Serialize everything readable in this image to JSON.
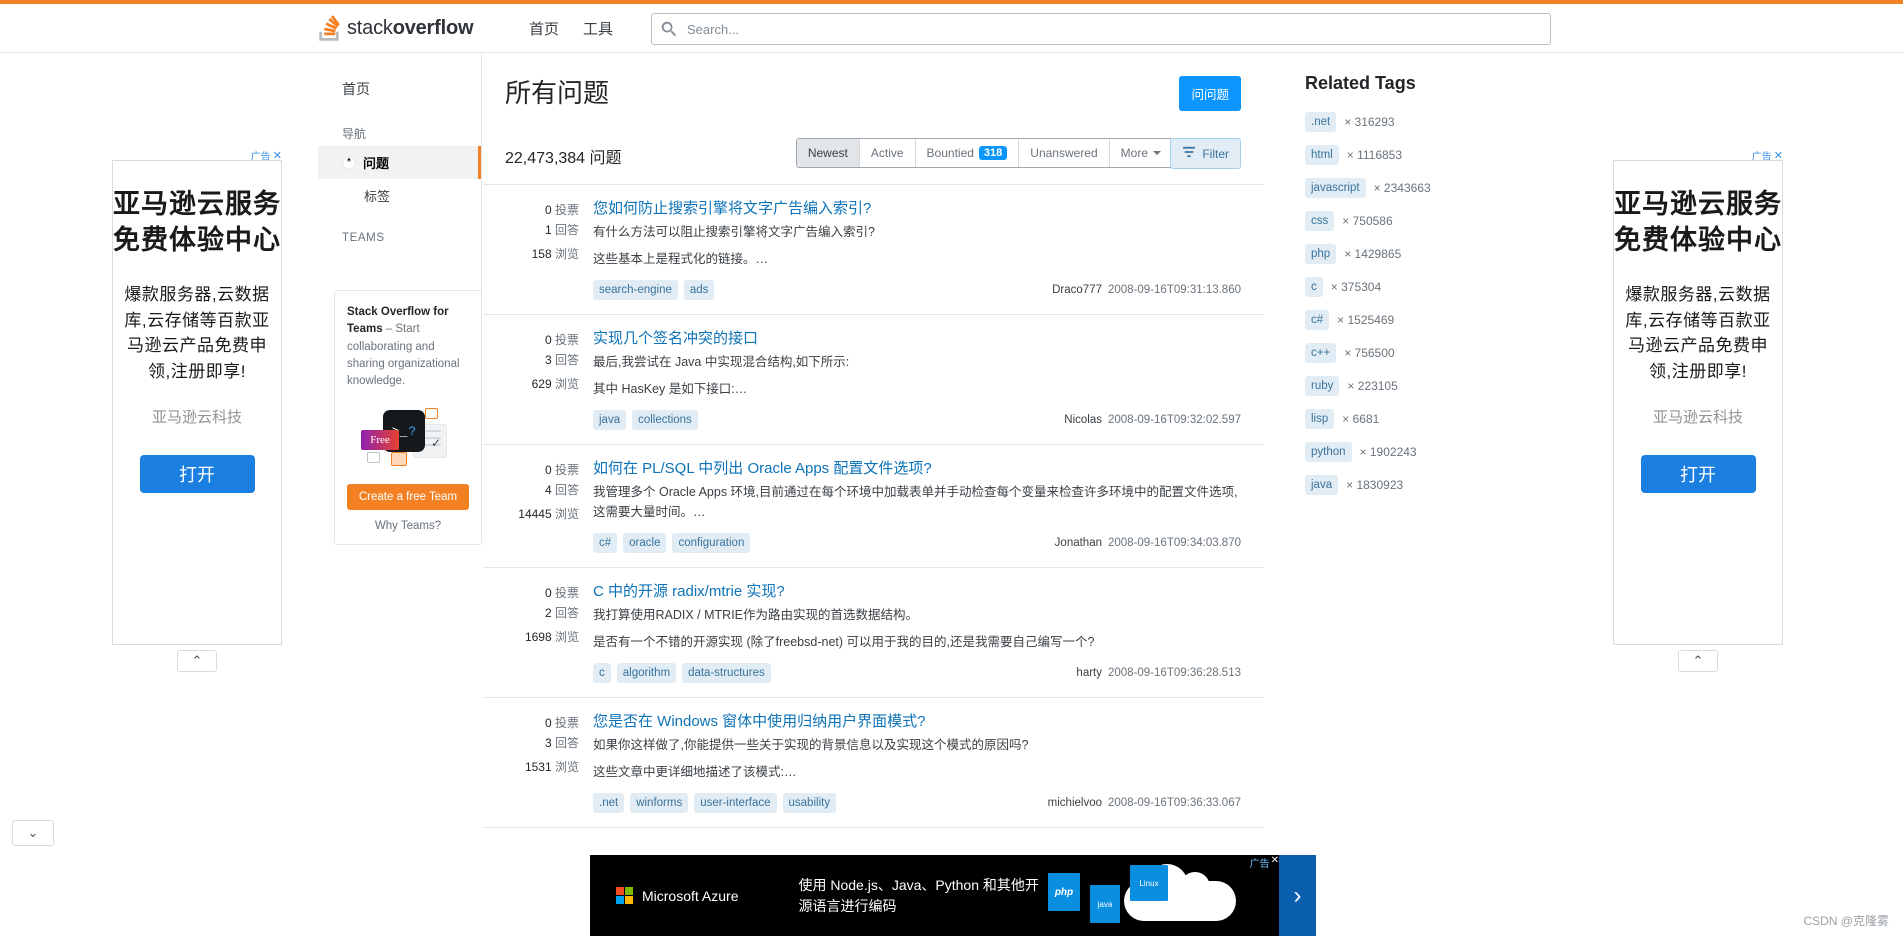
{
  "header": {
    "logo_text_light": "stack",
    "logo_text_bold": "overflow",
    "nav": [
      {
        "label": "首页",
        "name": "nav-home"
      },
      {
        "label": "工具",
        "name": "nav-tools"
      }
    ],
    "search_placeholder": "Search...",
    "search_value": ""
  },
  "sidebar": {
    "home_label": "首页",
    "section_nav": "导航",
    "items": [
      {
        "label": "问题",
        "active": true
      },
      {
        "label": "标签",
        "active": false
      }
    ],
    "section_teams": "TEAMS",
    "teams": {
      "title_bold": "Stack Overflow for Teams",
      "title_rest": " – Start collaborating and sharing organizational knowledge.",
      "terminal_glyph": ">_",
      "terminal_q": "?",
      "free_badge": "Free",
      "cta": "Create a free Team",
      "why": "Why Teams?"
    }
  },
  "main": {
    "page_title": "所有问题",
    "ask_button": "问问题",
    "question_count": "22,473,384 问题",
    "tabs": [
      {
        "label": "Newest",
        "active": true,
        "badge": null
      },
      {
        "label": "Active",
        "active": false,
        "badge": null
      },
      {
        "label": "Bountied",
        "active": false,
        "badge": "318"
      },
      {
        "label": "Unanswered",
        "active": false,
        "badge": null
      },
      {
        "label": "More",
        "active": false,
        "badge": null,
        "caret": true
      }
    ],
    "filter_button": "Filter",
    "labels": {
      "votes": "投票",
      "answers": "回答",
      "views": "浏览"
    },
    "questions": [
      {
        "votes": "0",
        "answers": "1",
        "views": "158",
        "title": "您如何防止搜索引擎将文字广告编入索引?",
        "excerpt_lines": [
          "有什么方法可以阻止搜索引擎将文字广告编入索引?",
          "这些基本上是程式化的链接。…"
        ],
        "tags": [
          "search-engine",
          "ads"
        ],
        "user": "Draco777",
        "time": "2008-09-16T09:31:13.860"
      },
      {
        "votes": "0",
        "answers": "3",
        "views": "629",
        "title": "实现几个签名冲突的接口",
        "excerpt_lines": [
          "最后,我尝试在 Java 中实现混合结构,如下所示:",
          "其中 HasKey 是如下接口:…"
        ],
        "tags": [
          "java",
          "collections"
        ],
        "user": "Nicolas",
        "time": "2008-09-16T09:32:02.597"
      },
      {
        "votes": "0",
        "answers": "4",
        "views": "14445",
        "title": "如何在 PL/SQL 中列出 Oracle Apps 配置文件选项?",
        "excerpt_lines": [
          "我管理多个 Oracle Apps 环境,目前通过在每个环境中加载表单并手动检查每个变量来检查许多环境中的配置文件选项,这需要大量时间。…"
        ],
        "tags": [
          "c#",
          "oracle",
          "configuration"
        ],
        "user": "Jonathan",
        "time": "2008-09-16T09:34:03.870"
      },
      {
        "votes": "0",
        "answers": "2",
        "views": "1698",
        "title": "C 中的开源 radix/mtrie 实现?",
        "excerpt_lines": [
          "我打算使用RADIX / MTRIE作为路由实现的首选数据结构。",
          "是否有一个不错的开源实现 (除了freebsd-net) 可以用于我的目的,还是我需要自己编写一个?"
        ],
        "tags": [
          "c",
          "algorithm",
          "data-structures"
        ],
        "user": "harty",
        "time": "2008-09-16T09:36:28.513"
      },
      {
        "votes": "0",
        "answers": "3",
        "views": "1531",
        "title": "您是否在 Windows 窗体中使用归纳用户界面模式?",
        "excerpt_lines": [
          "如果你这样做了,你能提供一些关于实现的背景信息以及实现这个模式的原因吗?",
          "这些文章中更详细地描述了该模式:…"
        ],
        "tags": [
          ".net",
          "winforms",
          "user-interface",
          "usability"
        ],
        "user": "michielvoo",
        "time": "2008-09-16T09:36:33.067"
      }
    ]
  },
  "related_tags": {
    "title": "Related Tags",
    "items": [
      {
        "tag": ".net",
        "count": "× 316293"
      },
      {
        "tag": "html",
        "count": "× 1116853"
      },
      {
        "tag": "javascript",
        "count": "× 2343663"
      },
      {
        "tag": "css",
        "count": "× 750586"
      },
      {
        "tag": "php",
        "count": "× 1429865"
      },
      {
        "tag": "c",
        "count": "× 375304"
      },
      {
        "tag": "c#",
        "count": "× 1525469"
      },
      {
        "tag": "c++",
        "count": "× 756500"
      },
      {
        "tag": "ruby",
        "count": "× 223105"
      },
      {
        "tag": "lisp",
        "count": "× 6681"
      },
      {
        "tag": "python",
        "count": "× 1902243"
      },
      {
        "tag": "java",
        "count": "× 1830923"
      }
    ]
  },
  "side_ads": {
    "ad_label": "广告",
    "close_glyph": "✕",
    "headline": "亚马逊云服务免费体验中心",
    "subtext": "爆款服务器,云数据库,云存储等百款亚马逊云产品免费申领,注册即享!",
    "brand": "亚马逊云科技",
    "cta": "打开",
    "collapse_glyph": "⌃"
  },
  "bottom_ad": {
    "brand": "Microsoft Azure",
    "text": "使用 Node.js、Java、Python 和其他开源语言进行编码",
    "cards": [
      "php",
      "java",
      "Linux"
    ],
    "ad_label": "广告",
    "close_glyph": "✕",
    "next_glyph": "›"
  },
  "edge_toggle_glyph": "⌄",
  "watermark": "CSDN @克隆雾",
  "colors": {
    "accent_orange": "#f48024",
    "link_blue": "#0c73b8",
    "ask_blue": "#0a95ff",
    "tag_bg": "#e1ecf4",
    "tag_fg": "#39739d"
  }
}
